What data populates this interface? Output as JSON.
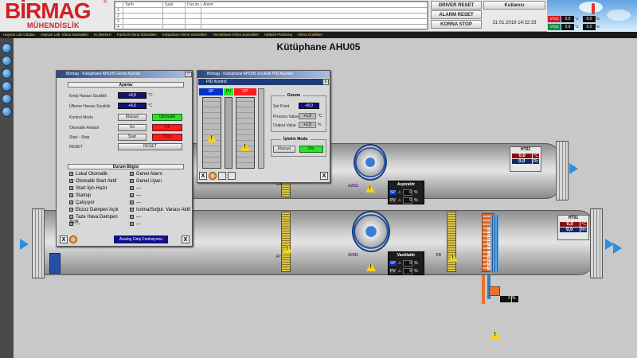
{
  "brand": {
    "name": "BİRMAG",
    "subtitle": "MÜHENDİSLİK",
    "reg": "®"
  },
  "alarm_table": {
    "headers": [
      "Tarih",
      "Saat",
      "Durum",
      "Alarm"
    ],
    "rows": [
      "1",
      "2",
      "3",
      "4"
    ]
  },
  "top_buttons": {
    "driver_reset": "DRIVER RESET",
    "alarm_reset": "ALARM RESET",
    "korna_stop": "KORNA STOP",
    "user": "Kullanıcı"
  },
  "datetime": "31.01.2019 14:32:33",
  "weather": {
    "vt01_label": "VT01",
    "vt01_temp": "0,0",
    "vt01_unit_t": "°C",
    "vt01_hum": "0,0",
    "vt01_unit_h": "%",
    "vt02_label": "VT02",
    "vt02_temp": "0,0",
    "vt02_hum": "0,0"
  },
  "menu": [
    "Hayvan Lab Odaları",
    "Hayvan Lab. Klima Santralleri",
    "Isı Merkezi",
    "Fanfcoil Klima Santralleri",
    "Kütüphane Klima Santralleri",
    "Yemekhane Klima Santralleri",
    "Haftalık Planlama",
    "Klima Grafikleri"
  ],
  "page_title": "Kütüphane AHU05",
  "general_dialog": {
    "title": "Birmag - Kütüphane AHU05 Genel Ayarlar",
    "section_settings": "Ayarlar",
    "rows": [
      {
        "label": "Emiş Havası Sıcaklık",
        "value": "+8,0",
        "unit": "°C"
      },
      {
        "label": "Üfleme Havası Sıcaklık",
        "value": "+8,0",
        "unit": "°C"
      }
    ],
    "mode_label": "Kontrol Modu",
    "mode_manual": "Manuel",
    "mode_auto": "Otomatik",
    "auto_restart_label": "Otomatik Restart",
    "auto_restart_on": "On",
    "auto_restart_off": "Off",
    "start_stop_label": "Start - Stop",
    "start": "Start",
    "stop": "Stop",
    "reset_label": "RESET",
    "reset_button": "RESET",
    "section_status": "Durum Bilgisi",
    "status_left": [
      "Lokal Otomatik",
      "Otomatik Start Aktif",
      "Start İçin Hazır",
      "Startup",
      "Çalışıyor",
      "Ekzoz Damperi Açık",
      "Taze Hava Damperi Açık",
      "---"
    ],
    "status_right": [
      "Genel Alarm",
      "Genel Uyarı",
      "---",
      "---",
      "---",
      "Isıtma/Soğut. Vanası Aktif",
      "---",
      "---"
    ],
    "footer_label": "Analog Giriş Fonksiyonu",
    "close": "X"
  },
  "pid_dialog": {
    "title": "Birmag - Kütüphane AHU05 Sıcaklık PID Ayarları",
    "tab": "PID Kontrol",
    "col_sp": "SP",
    "col_pv": "PV",
    "col_op": "OP",
    "section_durum": "Durum",
    "set_point_label": "Set Point",
    "set_point": "+8,0",
    "process_label": "Process Value",
    "process_value": "+1,0",
    "process_unit": "°C",
    "output_label": "Output Value",
    "output_value": "+1,0",
    "output_unit": "%",
    "section_mode": "İşletim Modu",
    "manual": "Manuel",
    "auto": "Oto.",
    "close": "X"
  },
  "plant": {
    "fan1_label": "AAS1",
    "fan2_label": "AVN1",
    "filter_g4": "G4",
    "filter_f7": "F7",
    "filter_f9": "F9",
    "coil_label": "SOĞUTMA BATARYASI",
    "aspirator": {
      "title": "Aspiratör",
      "sp": "SP",
      "pv": "PV",
      "sp_val": "0",
      "pv_val": "0",
      "unit": "%"
    },
    "vantilator": {
      "title": "Vantilatör",
      "sp": "SP",
      "pv": "PV",
      "sp_val": "0",
      "pv_val": "0",
      "unit": "%"
    },
    "ht02": {
      "title": "HT02",
      "t": "0,0",
      "t_unit": "°C",
      "h": "0,0",
      "h_unit": "Rh"
    },
    "ht01": {
      "title": "HT01",
      "t": "0,0",
      "t_unit": "°C",
      "h": "0,0",
      "h_unit": "Rh"
    },
    "valve_value": "0",
    "valve_unit": "%"
  },
  "colors": {
    "brand_red": "#d11f26",
    "sp_blue": "#0033cc",
    "pv_green": "#2ee02e",
    "op_red": "#ff1c1c"
  }
}
